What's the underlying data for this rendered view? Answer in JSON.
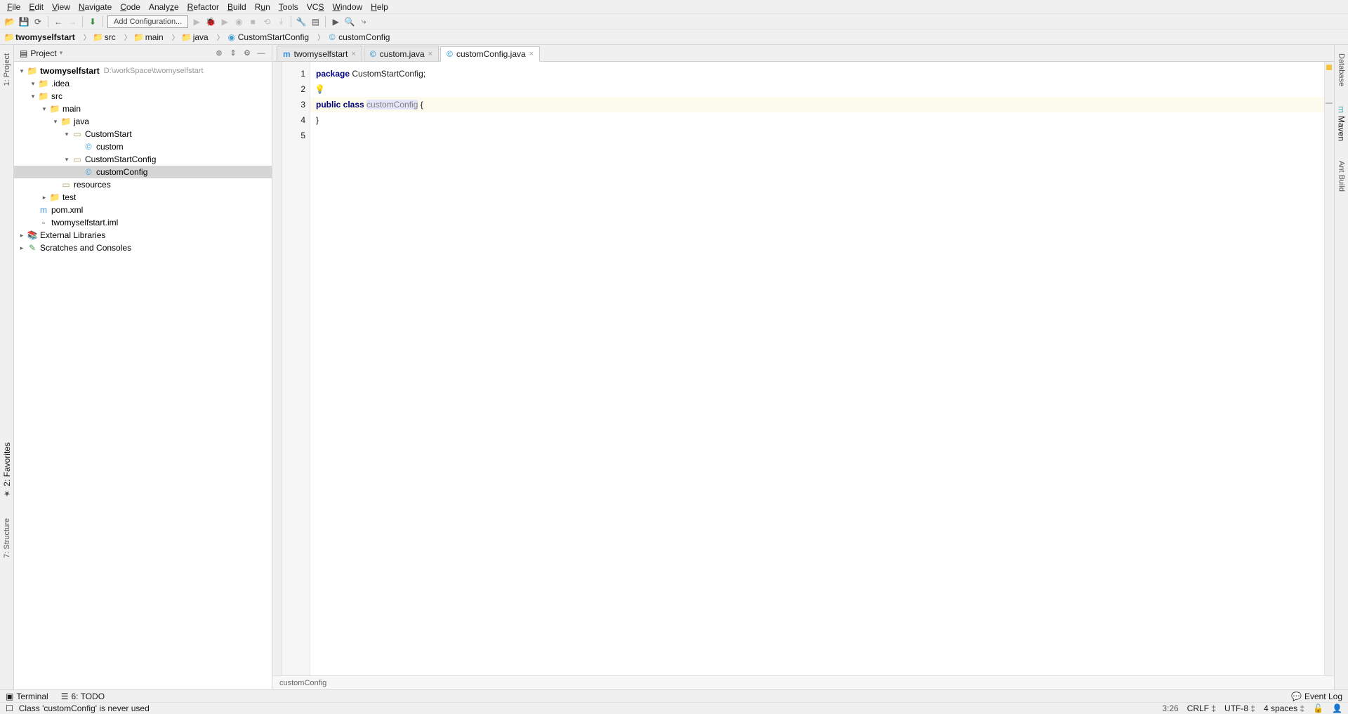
{
  "menu": [
    "File",
    "Edit",
    "View",
    "Navigate",
    "Code",
    "Analyze",
    "Refactor",
    "Build",
    "Run",
    "Tools",
    "VCS",
    "Window",
    "Help"
  ],
  "menuAccel": [
    "F",
    "E",
    "V",
    "N",
    "C",
    "",
    "R",
    "B",
    "R",
    "T",
    "S",
    "W",
    "H"
  ],
  "toolbar": {
    "addConfig": "Add Configuration..."
  },
  "breadcrumb": [
    "twomyselfstart",
    "src",
    "main",
    "java",
    "CustomStartConfig",
    "customConfig"
  ],
  "panel": {
    "title": "Project",
    "root": {
      "name": "twomyselfstart",
      "path": "D:\\workSpace\\twomyselfstart"
    },
    "tree": [
      {
        "indent": 1,
        "arrow": "▾",
        "icon": "folder",
        "label": ".idea"
      },
      {
        "indent": 1,
        "arrow": "▾",
        "icon": "folder",
        "label": "src"
      },
      {
        "indent": 2,
        "arrow": "▾",
        "icon": "folder-blue",
        "label": "main"
      },
      {
        "indent": 3,
        "arrow": "▾",
        "icon": "folder-blue",
        "label": "java"
      },
      {
        "indent": 4,
        "arrow": "▾",
        "icon": "package",
        "label": "CustomStart"
      },
      {
        "indent": 5,
        "arrow": "",
        "icon": "class",
        "label": "custom"
      },
      {
        "indent": 4,
        "arrow": "▾",
        "icon": "package",
        "label": "CustomStartConfig"
      },
      {
        "indent": 5,
        "arrow": "",
        "icon": "class",
        "label": "customConfig",
        "sel": true
      },
      {
        "indent": 3,
        "arrow": "",
        "icon": "folder-res",
        "label": "resources"
      },
      {
        "indent": 2,
        "arrow": "▸",
        "icon": "folder",
        "label": "test"
      },
      {
        "indent": 1,
        "arrow": "",
        "icon": "maven",
        "label": "pom.xml"
      },
      {
        "indent": 1,
        "arrow": "",
        "icon": "iml",
        "label": "twomyselfstart.iml"
      }
    ],
    "extLib": "External Libraries",
    "scratch": "Scratches and Consoles"
  },
  "tabs": [
    {
      "icon": "m",
      "label": "twomyselfstart",
      "active": false
    },
    {
      "icon": "c",
      "label": "custom.java",
      "active": false
    },
    {
      "icon": "c",
      "label": "customConfig.java",
      "active": true
    }
  ],
  "code": {
    "lines": [
      "1",
      "2",
      "3",
      "4",
      "5"
    ],
    "l1_kw": "package",
    "l1_rest": " CustomStartConfig;",
    "l3_kw": "public class ",
    "l3_cls": "customConfig",
    "l3_rest": " {",
    "l4": "}",
    "breadcrumb": "customConfig"
  },
  "leftTabs": {
    "project": "1: Project",
    "structure": "7: Structure",
    "favorites": "2: Favorites"
  },
  "rightTabs": {
    "database": "Database",
    "maven": "Maven",
    "ant": "Ant Build"
  },
  "bottom": {
    "terminal": "Terminal",
    "todo": "6: TODO",
    "eventlog": "Event Log"
  },
  "status": {
    "msg": "Class 'customConfig' is never used",
    "pos": "3:26",
    "crlf": "CRLF",
    "enc": "UTF-8",
    "indent": "4 spaces"
  }
}
